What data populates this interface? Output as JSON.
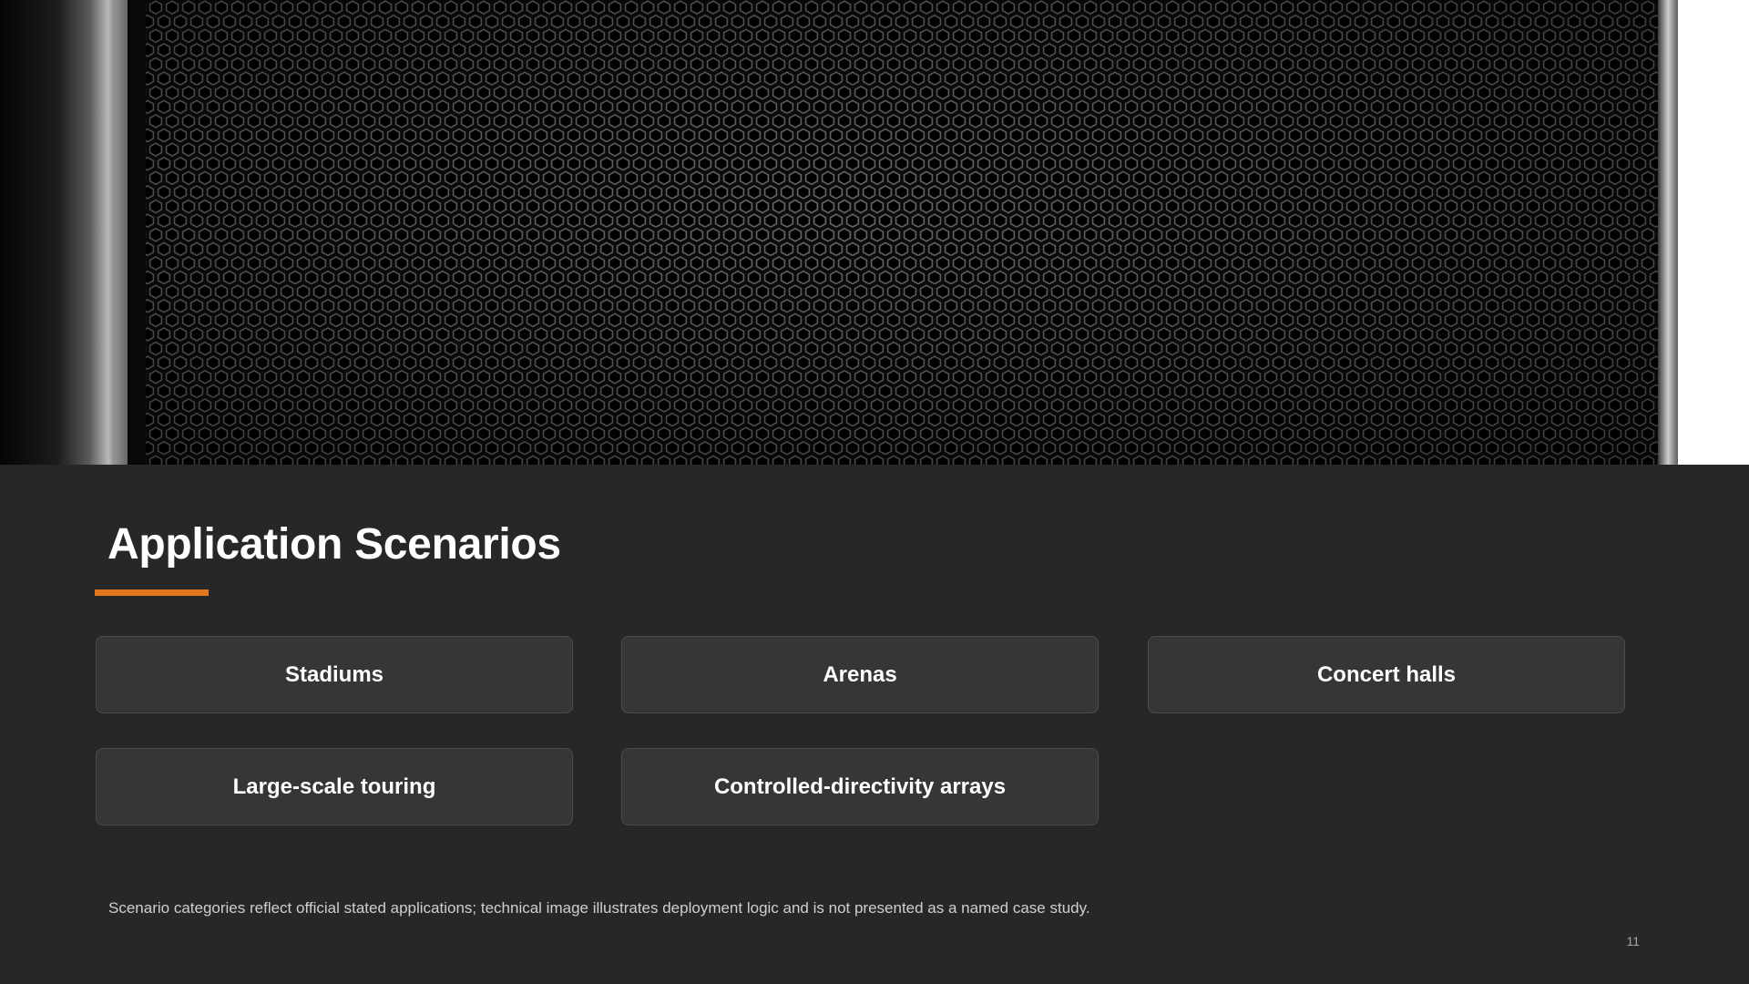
{
  "slide": {
    "title": "Application Scenarios",
    "accent_color": "#e0781f",
    "hero_image": {
      "subject": "speaker-grille-photo"
    },
    "scenarios": [
      {
        "label": "Stadiums"
      },
      {
        "label": "Arenas"
      },
      {
        "label": "Concert halls"
      },
      {
        "label": "Large-scale touring"
      },
      {
        "label": "Controlled-directivity arrays"
      }
    ],
    "footnote": "Scenario categories reflect official stated applications; technical image illustrates deployment logic and is not presented as a named case study.",
    "page_number": "11"
  }
}
